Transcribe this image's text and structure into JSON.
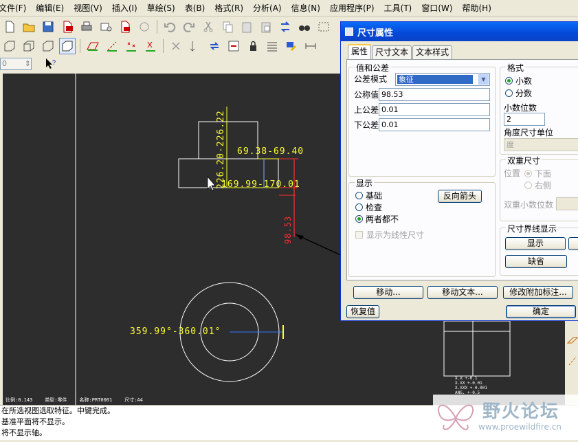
{
  "menu": [
    "文件(F)",
    "编辑(E)",
    "视图(V)",
    "插入(I)",
    "草绘(S)",
    "表(B)",
    "格式(R)",
    "分析(A)",
    "信息(N)",
    "应用程序(P)",
    "工具(T)",
    "窗口(W)",
    "帮助(H)"
  ],
  "toolbar3": {
    "input_value": "0"
  },
  "canvas": {
    "dim_vertical": "226.20-226.22",
    "dim_h1": "69.38-69.40",
    "dim_h2": "169.99-170.01",
    "dim_red": "98.53",
    "dim_angle": "359.99°-360.01°",
    "status": [
      "比例:0.143",
      "类型:零件",
      "名称:PRT0001",
      "尺寸:A4"
    ],
    "tol_table": [
      "X.X   +-0.1",
      "X.XX  +-0.01",
      "X.XXX +-0.001",
      "ANG.  +-0.5"
    ]
  },
  "messages": [
    "在所选视图选取特征。中键完成。",
    "基准平面将不显示。",
    "将不显示轴。"
  ],
  "watermark": {
    "title": "野火论坛",
    "url": "www.proewildfire.cn"
  },
  "dialog": {
    "title": "尺寸属性",
    "tabs": [
      "属性",
      "尺寸文本",
      "文本样式"
    ],
    "tolerance_group": "值和公差",
    "tol_mode_label": "公差模式",
    "tol_mode_value": "象征",
    "nominal_label": "公称值",
    "nominal_value": "98.53",
    "upper_label": "上公差",
    "upper_value": "0.01",
    "lower_label": "下公差",
    "lower_value": "0.01",
    "format_group": "格式",
    "decimal": "小数",
    "fraction": "分数",
    "decimal_places_label": "小数位数",
    "decimal_places_value": "2",
    "angle_unit_label": "角度尺寸单位",
    "angle_unit_value": "度",
    "display_group": "显示",
    "basic": "基础",
    "inspection": "检查",
    "neither": "两者都不",
    "flip_arrows": "反向箭头",
    "show_linear": "显示为线性尺寸",
    "dual_group": "双重尺寸",
    "position_label": "位置",
    "below": "下面",
    "right": "右侧",
    "dual_decimal_label": "双重小数位数",
    "witness_group": "尺寸界线显示",
    "show": "显示",
    "default": "缺省",
    "move": "移动...",
    "move_text": "移动文本...",
    "modify_attach": "修改附加标注...",
    "restore": "恢复值",
    "ok": "确定"
  },
  "colors": {
    "canvas": "#2d2d2d",
    "dimension": "#ffff33",
    "selected": "#ff2d2d",
    "titlebar": "#0548d8"
  }
}
